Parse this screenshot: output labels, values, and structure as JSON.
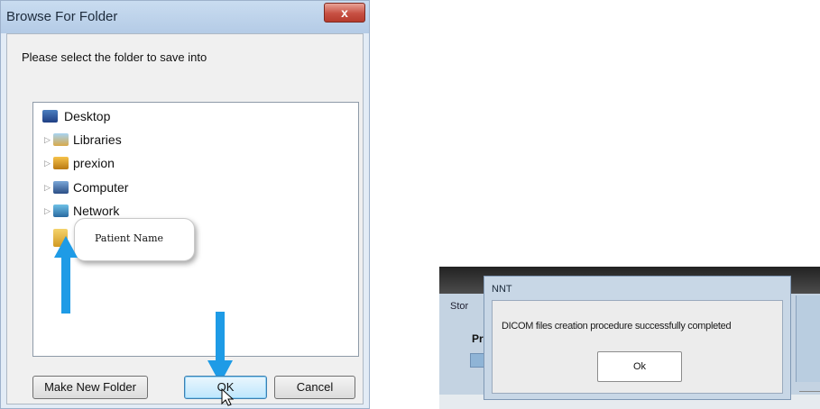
{
  "browse_dialog": {
    "title": "Browse For Folder",
    "close_label": "x",
    "prompt": "Please select the folder to save into",
    "tree_items": [
      {
        "label": "Desktop",
        "icon": "desktop-icon"
      },
      {
        "label": "Libraries",
        "icon": "libraries-icon"
      },
      {
        "label": "prexion",
        "icon": "user-folder-icon"
      },
      {
        "label": "Computer",
        "icon": "computer-icon"
      },
      {
        "label": "Network",
        "icon": "network-icon"
      }
    ],
    "callout_text": "Patient Name",
    "buttons": {
      "make_new_folder": "Make New Folder",
      "ok": "OK",
      "cancel": "Cancel"
    },
    "arrow_color": "#1e9be6"
  },
  "nnt_dialog": {
    "background_window_label": "Stor",
    "background_heading": "Pr",
    "title": "NNT",
    "message": "DICOM files creation procedure successfully completed",
    "ok_label": "Ok"
  }
}
